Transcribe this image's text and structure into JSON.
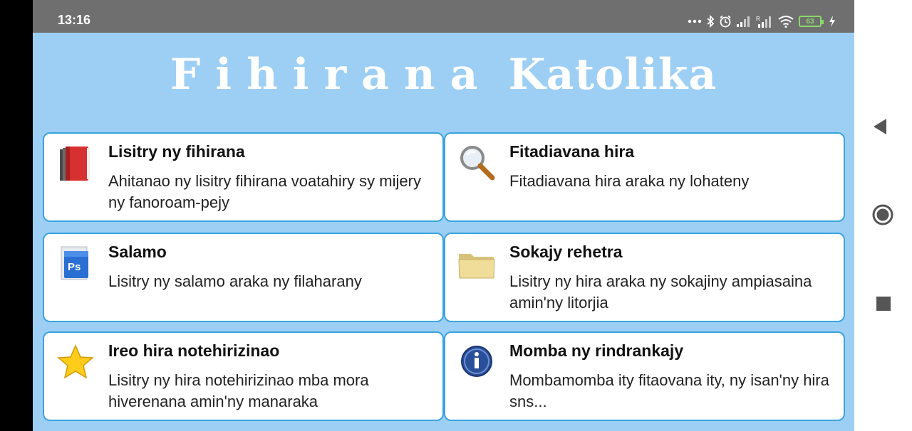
{
  "status_bar": {
    "time": "13:16",
    "icons": [
      "more-dots-icon",
      "bluetooth-icon",
      "alarm-icon",
      "signal-icon",
      "signal-roaming-icon",
      "wifi-icon",
      "battery-icon",
      "charging-icon"
    ],
    "battery_level": "63"
  },
  "app": {
    "title_word1": "Fihirana",
    "title_word2": "Katolika"
  },
  "menu": [
    {
      "title": "Lisitry ny fihirana",
      "description": "Ahitanao ny lisitry fihirana voatahiry sy mijery ny fanoroam-pejy",
      "icon": "books-icon"
    },
    {
      "title": "Fitadiavana hira",
      "description": "Fitadiavana hira araka ny lohateny",
      "icon": "magnifier-icon"
    },
    {
      "title": "Salamo",
      "description": "Lisitry ny salamo araka ny filaharany",
      "icon": "ps-document-icon"
    },
    {
      "title": "Sokajy rehetra",
      "description": "Lisitry ny hira araka ny sokajiny ampiasaina amin'ny litorjia",
      "icon": "folder-icon"
    },
    {
      "title": "Ireo hira notehirizinao",
      "description": "Lisitry ny hira notehirizinao mba mora hiverenana amin'ny manaraka",
      "icon": "star-icon"
    },
    {
      "title": "Momba ny rindrankajy",
      "description": "Mombamomba ity fitaovana ity, ny isan'ny hira sns...",
      "icon": "info-icon"
    }
  ],
  "colors": {
    "background": "#9dcff5",
    "card_border": "#3aa3dd",
    "status_bar": "#6f6f6f"
  }
}
